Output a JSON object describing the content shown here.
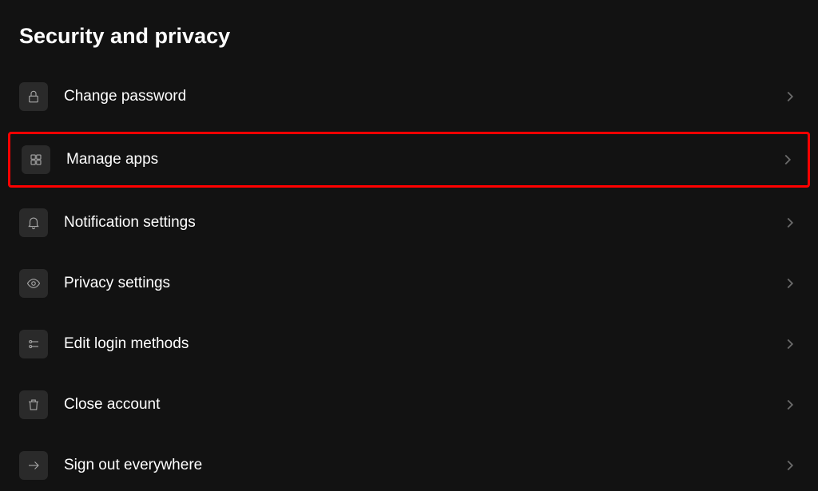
{
  "page": {
    "title": "Security and privacy"
  },
  "items": [
    {
      "id": "change-password",
      "label": "Change password",
      "icon": "lock",
      "highlighted": false
    },
    {
      "id": "manage-apps",
      "label": "Manage apps",
      "icon": "apps",
      "highlighted": true
    },
    {
      "id": "notification-settings",
      "label": "Notification settings",
      "icon": "bell",
      "highlighted": false
    },
    {
      "id": "privacy-settings",
      "label": "Privacy settings",
      "icon": "eye",
      "highlighted": false
    },
    {
      "id": "edit-login-methods",
      "label": "Edit login methods",
      "icon": "sliders",
      "highlighted": false
    },
    {
      "id": "close-account",
      "label": "Close account",
      "icon": "trash",
      "highlighted": false
    },
    {
      "id": "sign-out-everywhere",
      "label": "Sign out everywhere",
      "icon": "arrow-right",
      "highlighted": false
    }
  ]
}
